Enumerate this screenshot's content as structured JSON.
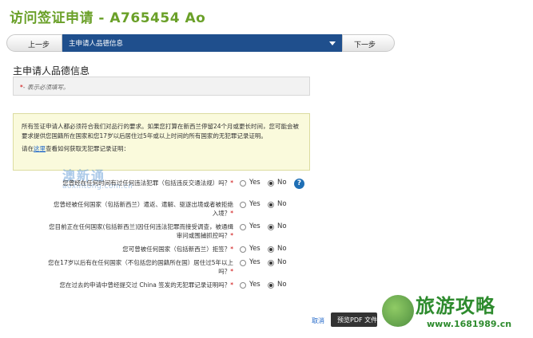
{
  "app": {
    "title": "访问签证申请 - A765454 Ao"
  },
  "nav": {
    "prev_label": "上一步",
    "current_section": "主申请人品德信息",
    "next_label": "下一步"
  },
  "section": {
    "title": "主申请人品德信息",
    "required_star": "*",
    "required_text": "- 表示必须填写。"
  },
  "notice": {
    "paragraph1": "所有签证申请人都必须符合我们对品行的要求。如果您打算在新西兰停留24个月或更长时间，您可能会被要求提供您国籍所在国家和您17岁以后居住过5年或以上时间的所有国家的无犯罪记录证明。",
    "link_prefix": "请在",
    "link_text": "这里",
    "link_suffix": "查看如何获取无犯罪记录证明："
  },
  "watermark": {
    "line1": "澳新通",
    "line2": "aoxintong.com.cn"
  },
  "questions": [
    {
      "label": "您曾经在任何时间有过任何违法犯罪（包括违反交通法规）吗？",
      "star": "*",
      "yes": "Yes",
      "no": "No",
      "selected": "No"
    },
    {
      "label": "您曾经被任何国家（包括新西兰）遣返、遣解、驱逐出境或者被拒绝入境？",
      "star": "*",
      "yes": "Yes",
      "no": "No",
      "selected": "No"
    },
    {
      "label": "您目前正在任何国家(包括新西兰)因任何违法犯罪而接受调查，被通缉审问或围捕抓控吗？",
      "star": "*",
      "yes": "Yes",
      "no": "No",
      "selected": "No"
    },
    {
      "label": "您可曾被任何国家（包括新西兰）拒签？",
      "star": "*",
      "yes": "Yes",
      "no": "No",
      "selected": "No"
    },
    {
      "label": "您在17岁以后有在任何国家（不包括您的国籍所在国）居住过5年以上吗？",
      "star": "*",
      "yes": "Yes",
      "no": "No",
      "selected": "No"
    },
    {
      "label": "您在过去的申请中曾经提交过 China 签发的无犯罪记录证明吗？",
      "star": "*",
      "yes": "Yes",
      "no": "No",
      "selected": "No"
    }
  ],
  "help_icon": {
    "glyph": "?"
  },
  "footer": {
    "cancel_label": "取消",
    "preview_label": "预览PDF 文件"
  },
  "corner_logo": {
    "brand": "旅游攻略",
    "url": "www.1681989.cn"
  },
  "colors": {
    "title_green": "#6aa028",
    "nav_blue": "#1f4f8d",
    "required_red": "#cc0000",
    "link_blue": "#1f66c8",
    "notice_bg": "#fafadc"
  }
}
